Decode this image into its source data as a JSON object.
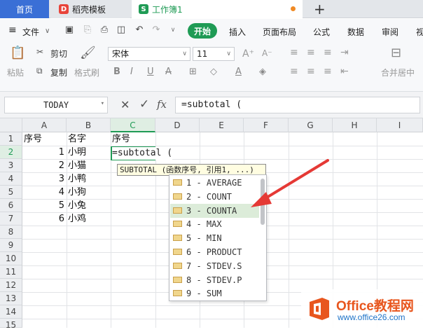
{
  "tabs": {
    "home": "首页",
    "template": "稻壳模板",
    "workbook": "工作簿1",
    "template_icon": "D",
    "workbook_icon": "S"
  },
  "menu": {
    "file": "文件",
    "start": "开始",
    "insert": "插入",
    "layout": "页面布局",
    "formula": "公式",
    "data": "数据",
    "review": "审阅",
    "view_partial": "视"
  },
  "ribbon": {
    "paste": "粘贴",
    "cut": "剪切",
    "copy": "复制",
    "format_painter": "格式刷",
    "font_name": "宋体",
    "font_size": "11",
    "merge_center": "合并居中"
  },
  "formula_bar": {
    "name_box": "TODAY",
    "fx": "fx",
    "formula": "=subtotal ("
  },
  "columns": [
    "A",
    "B",
    "C",
    "D",
    "E",
    "F",
    "G",
    "H",
    "I"
  ],
  "rows": [
    "1",
    "2",
    "3",
    "4",
    "5",
    "6",
    "7",
    "8",
    "9",
    "10",
    "11",
    "12",
    "13",
    "14",
    "15"
  ],
  "cells": {
    "A1": "序号",
    "B1": "名字",
    "C1": "序号",
    "A2": "1",
    "B2": "小明",
    "A3": "2",
    "B3": "小猫",
    "A4": "3",
    "B4": "小鸭",
    "A5": "4",
    "B5": "小狗",
    "A6": "5",
    "B6": "小兔",
    "A7": "6",
    "B7": "小鸡"
  },
  "cell_edit": "=subtotal (",
  "tooltip": "SUBTOTAL (函数序号, 引用1, ...)",
  "dropdown_items": [
    "1 - AVERAGE",
    "2 - COUNT",
    "3 - COUNTA",
    "4 - MAX",
    "5 - MIN",
    "6 - PRODUCT",
    "7 - STDEV.S",
    "8 - STDEV.P",
    "9 - SUM"
  ],
  "selected_index": 2,
  "watermark": {
    "title": "Office教程网",
    "url": "www.office26.com"
  },
  "colors": {
    "accent": "#1f9b55",
    "home_tab": "#3a6fd6",
    "arrow": "#e53935",
    "watermark": "#e8561e"
  }
}
